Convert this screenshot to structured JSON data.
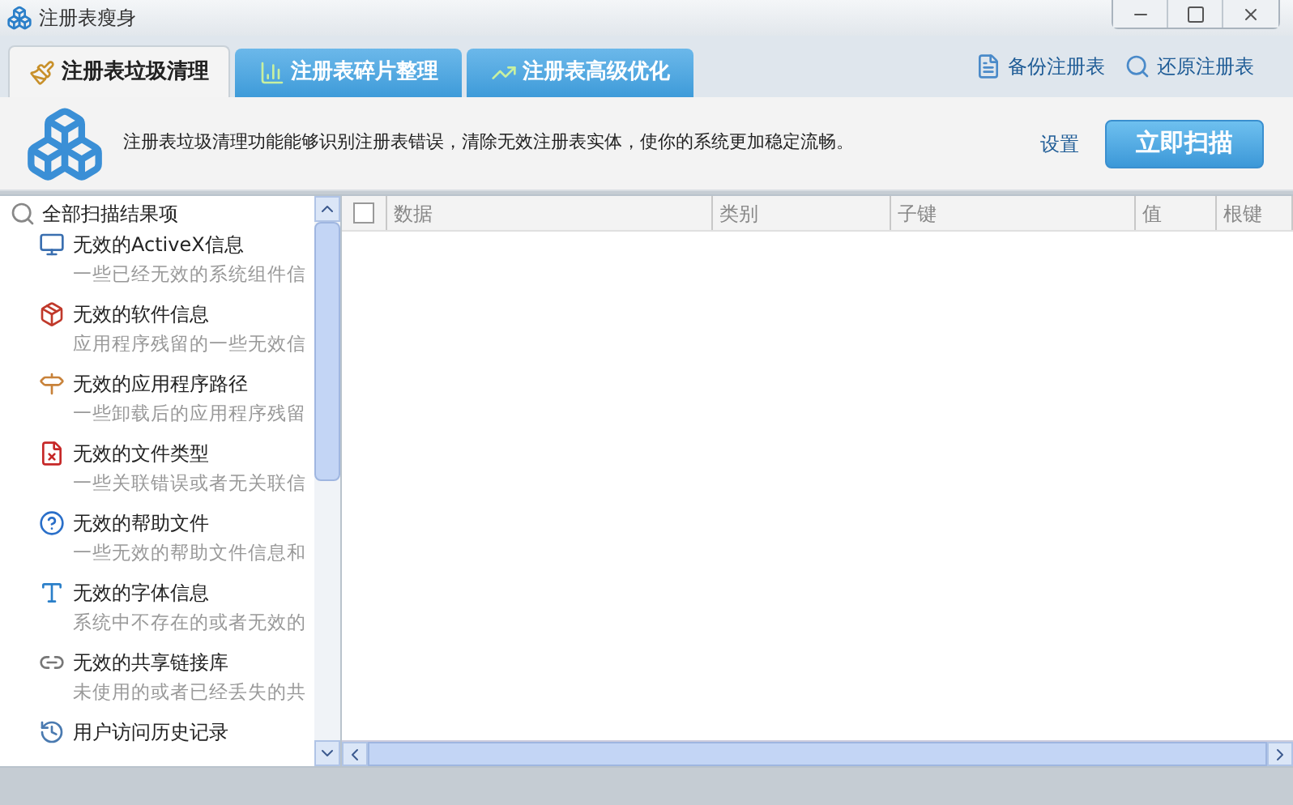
{
  "window": {
    "title": "注册表瘦身"
  },
  "tabs": [
    {
      "label": "注册表垃圾清理",
      "selected": true
    },
    {
      "label": "注册表碎片整理",
      "selected": false
    },
    {
      "label": "注册表高级优化",
      "selected": false
    }
  ],
  "toolbar_links": [
    "备份注册表",
    "还原注册表"
  ],
  "banner": {
    "description": "注册表垃圾清理功能能够识别注册表错误，清除无效注册表实体，使你的系统更加稳定流畅。",
    "settings_link": "设置",
    "scan_button": "立即扫描"
  },
  "scan_results": {
    "label": "全部扫描结果项",
    "children": [
      {
        "title": "无效的ActiveX信息",
        "description": "一些已经无效的系统组件信"
      },
      {
        "title": "无效的软件信息",
        "description": "应用程序残留的一些无效信"
      },
      {
        "title": "无效的应用程序路径",
        "description": "一些卸载后的应用程序残留"
      },
      {
        "title": "无效的文件类型",
        "description": "一些关联错误或者无关联信"
      },
      {
        "title": "无效的帮助文件",
        "description": "一些无效的帮助文件信息和"
      },
      {
        "title": "无效的字体信息",
        "description": "系统中不存在的或者无效的"
      },
      {
        "title": "无效的共享链接库",
        "description": "未使用的或者已经丢失的共"
      },
      {
        "title": "用户访问历史记录"
      }
    ]
  },
  "table": {
    "select_all_checked": false,
    "columns": [
      "数据",
      "类别",
      "子键",
      "值",
      "根键"
    ]
  }
}
